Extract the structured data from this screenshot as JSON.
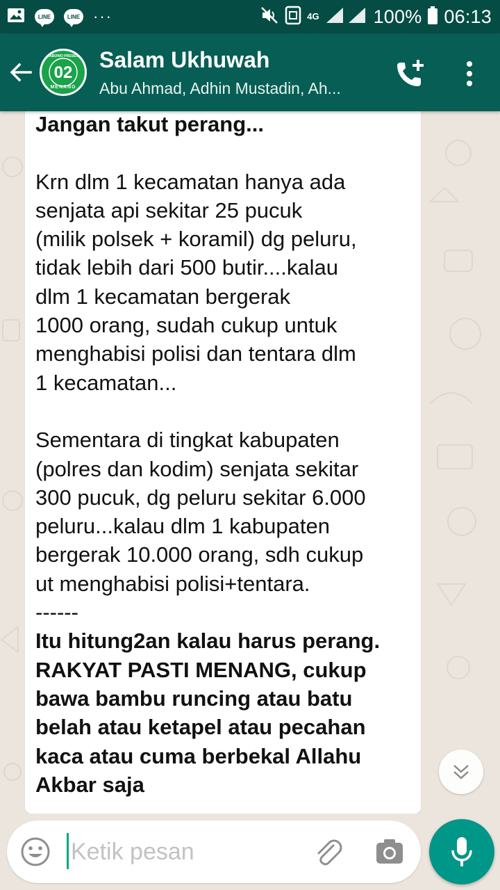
{
  "status_bar": {
    "battery_text": "100%",
    "time": "06:13",
    "network_label": "4G",
    "line_app_label": "LINE",
    "icons": [
      "image-icon",
      "line-icon",
      "line-icon",
      "more-notifications-icon",
      "mute-icon",
      "nfc-icon",
      "signal-icon",
      "battery-icon"
    ]
  },
  "header": {
    "title": "Salam Ukhuwah",
    "subtitle": "Abu Ahmad, Adhin Mustadin, Ah...",
    "avatar_text": "02",
    "avatar_text_top": "PRABOWO PRESIDEN",
    "avatar_text_bottom": "MENANG",
    "accent_color": "#075e54",
    "status_bar_color": "#054d44"
  },
  "message": {
    "line_1": "Jangan takut perang...",
    "para_1": [
      "Krn dlm 1 kecamatan hanya ada",
      "senjata api sekitar 25 pucuk",
      "(milik polsek + koramil) dg peluru,",
      "tidak lebih dari 500 butir....kalau",
      "dlm 1 kecamatan bergerak",
      "1000 orang, sudah cukup untuk",
      "menghabisi polisi dan tentara dlm",
      "1 kecamatan..."
    ],
    "para_2": [
      "Sementara di tingkat kabupaten",
      "(polres dan kodim) senjata sekitar",
      "300 pucuk, dg peluru sekitar 6.000",
      "peluru...kalau dlm 1 kabupaten",
      "bergerak 10.000 orang, sdh cukup",
      "ut menghabisi polisi+tentara."
    ],
    "separator_1": "------",
    "bold_para": [
      "Itu hitung2an kalau harus perang.",
      "RAKYAT PASTI MENANG, cukup",
      "bawa bambu runcing atau batu",
      "belah atau ketapel atau pecahan",
      "kaca atau cuma berbekal Allahu",
      "Akbar saja"
    ],
    "separator_2": "-----"
  },
  "input": {
    "placeholder": "Ketik pesan",
    "value": ""
  },
  "colors": {
    "fab": "#009688",
    "chat_background": "#ece5dd",
    "bubble": "#ffffff"
  }
}
